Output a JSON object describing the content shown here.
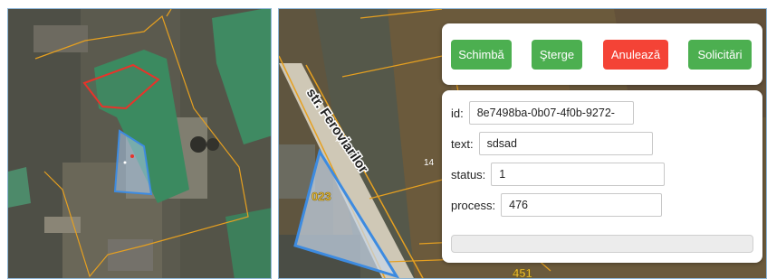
{
  "toolbar": {
    "change_label": "Schimbă",
    "delete_label": "Şterge",
    "cancel_label": "Anulează",
    "requests_label": "Solicitări"
  },
  "form": {
    "id_label": "id:",
    "id_value": "8e7498ba-0b07-4f0b-9272-",
    "text_label": "text:",
    "text_value": "sdsad",
    "status_label": "status:",
    "status_value": "1",
    "process_label": "process:",
    "process_value": "476",
    "progress": 0
  },
  "map_right": {
    "street_label": "str. Feroviarilor",
    "parcel_number": "14",
    "polygon_label": "023",
    "bottom_label": "451"
  },
  "colors": {
    "button_green": "#4caf50",
    "button_red": "#f44336",
    "polygon_blue": "#3d8be0",
    "polygon_red": "#e8332a",
    "boundary_orange": "#e6a020"
  }
}
